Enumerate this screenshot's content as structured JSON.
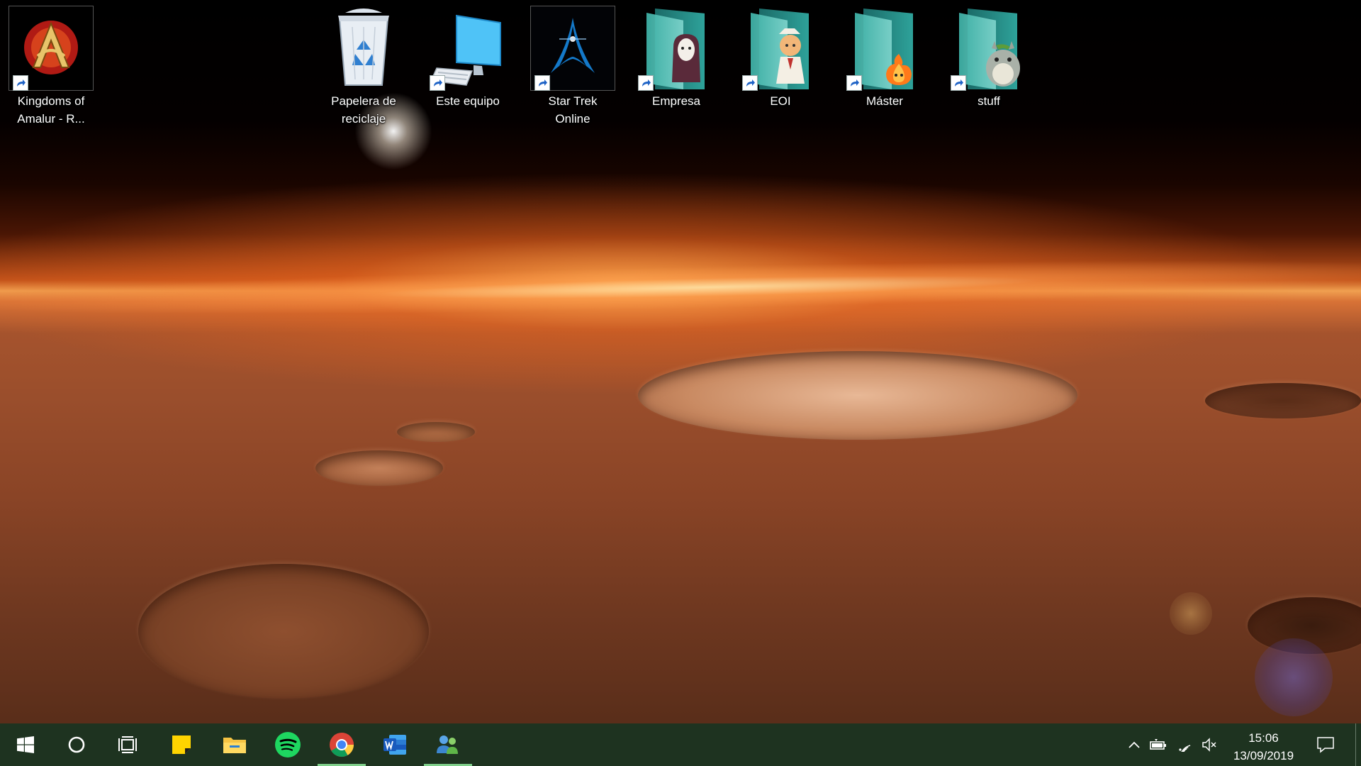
{
  "desktop": {
    "wallpaper": "mars-horizon",
    "icons": [
      {
        "label": "Kingdoms of Amalur - R...",
        "icon": "amalur-game-icon",
        "shortcut": true
      },
      {
        "label": "Papelera de reciclaje",
        "icon": "recycle-bin-icon",
        "shortcut": false
      },
      {
        "label": "Este equipo",
        "icon": "computer-icon",
        "shortcut": true
      },
      {
        "label": "Star Trek Online",
        "icon": "star-trek-icon",
        "shortcut": true
      },
      {
        "label": "Empresa",
        "icon": "folder-icon",
        "shortcut": true
      },
      {
        "label": "EOI",
        "icon": "folder-icon",
        "shortcut": true
      },
      {
        "label": "Máster",
        "icon": "folder-icon",
        "shortcut": true
      },
      {
        "label": "stuff",
        "icon": "folder-icon",
        "shortcut": true
      }
    ]
  },
  "taskbar": {
    "background": "#1e3320",
    "accent": "#7fcf8a",
    "buttons": [
      {
        "name": "start",
        "icon": "windows-logo-icon"
      },
      {
        "name": "search",
        "icon": "cortana-circle-icon"
      },
      {
        "name": "task-view",
        "icon": "task-view-icon"
      },
      {
        "name": "sticky-notes",
        "icon": "sticky-notes-icon"
      },
      {
        "name": "file-explorer",
        "icon": "folder-icon"
      },
      {
        "name": "spotify",
        "icon": "spotify-icon"
      },
      {
        "name": "chrome",
        "icon": "chrome-icon",
        "active": true
      },
      {
        "name": "word",
        "icon": "word-icon"
      },
      {
        "name": "people",
        "icon": "people-icon",
        "active": true
      }
    ],
    "tray": {
      "icons": [
        "chevron-up-icon",
        "battery-icon",
        "wifi-icon",
        "volume-muted-icon"
      ],
      "time": "15:06",
      "date": "13/09/2019",
      "notification_icon": "action-center-icon"
    }
  }
}
